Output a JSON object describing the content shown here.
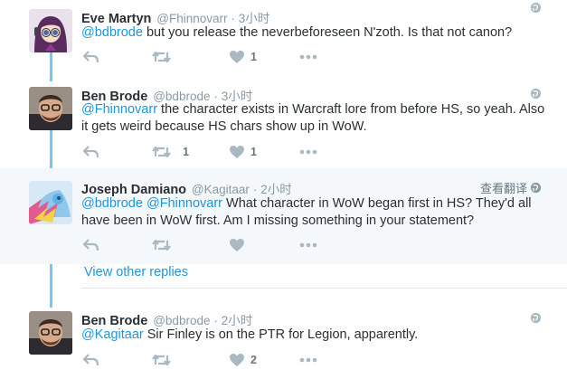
{
  "tweets": [
    {
      "fullname": "Eve Martyn",
      "handle": "@Fhinnovarr",
      "time": "3小时",
      "mention": "@bdbrode",
      "text": " but you release the neverbeforeseen N'zoth. Is that not canon?",
      "retweets": "",
      "likes": "1"
    },
    {
      "fullname": "Ben Brode",
      "handle": "@bdbrode",
      "time": "3小时",
      "mention": "@Fhinnovarr",
      "text": " the character exists in Warcraft lore from before HS, so yeah. Also it gets weird because HS chars show up in WoW.",
      "retweets": "1",
      "likes": "1"
    },
    {
      "fullname": "Joseph Damiano",
      "handle": "@Kagitaar",
      "time": "2小时",
      "translate": "查看翻译",
      "mention": "@bdbrode",
      "mention2": "@Fhinnovarr",
      "text": " What character in WoW began first in HS? They'd all have been in WoW first. Am I missing something in your statement?",
      "retweets": "",
      "likes": ""
    },
    {
      "fullname": "Ben Brode",
      "handle": "@bdbrode",
      "time": "2小时",
      "mention": "@Kagitaar",
      "text": " Sir Finley is on the PTR for Legion, apparently.",
      "retweets": "",
      "likes": "2"
    }
  ],
  "view_other_replies": "View other replies",
  "colors": {
    "thread_line": "#71c9f8",
    "mention": "#1b95e0",
    "muted": "#8899a6",
    "highlight_bg": "#f5f8fa"
  },
  "icons": [
    "reply-icon",
    "retweet-icon",
    "like-icon",
    "more-icon",
    "globe-icon"
  ]
}
